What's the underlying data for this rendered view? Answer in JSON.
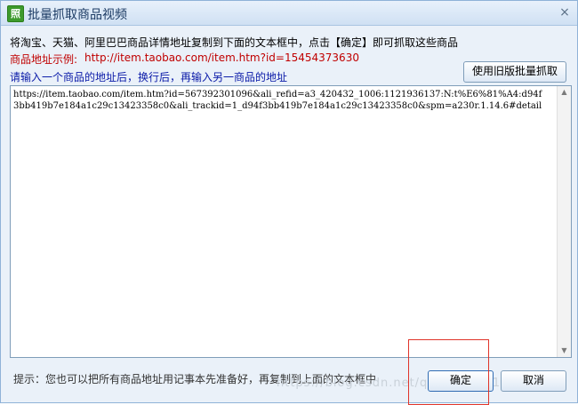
{
  "window": {
    "app_icon_text": "照",
    "title": "批量抓取商品视频",
    "close_glyph": "×"
  },
  "instructions": "将淘宝、天猫、阿里巴巴商品详情地址复制到下面的文本框中，点击【确定】即可抓取这些商品",
  "example": {
    "label": "商品地址示例:",
    "url": "http://item.taobao.com/item.htm?id=15454373630"
  },
  "hint": "请输入一个商品的地址后，换行后，再输入另一商品的地址",
  "old_version_button": "使用旧版批量抓取",
  "url_input": {
    "value": "https://item.taobao.com/item.htm?id=567392301096&ali_refid=a3_420432_1006:1121936137:N:t%E6%81%A4:d94f3bb419b7e184a1c29c13423358c0&ali_trackid=1_d94f3bb419b7e184a1c29c13423358c0&spm=a230r.1.14.6#detail"
  },
  "footer": {
    "tip": "提示：您也可以把所有商品地址用记事本先准备好，再复制到上面的文本框中",
    "ok_label": "确定",
    "cancel_label": "取消"
  },
  "watermark": "https://blog.csdn.net/qq_41578210",
  "colors": {
    "example_red": "#c00000",
    "hint_blue": "#0a1aa8",
    "highlight_red": "#e0342a"
  }
}
